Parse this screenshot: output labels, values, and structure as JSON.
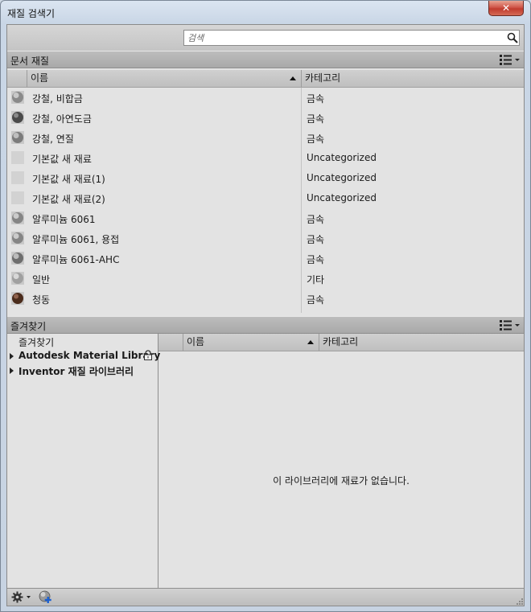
{
  "window": {
    "title": "재질 검색기",
    "close_glyph": "✕"
  },
  "search": {
    "placeholder": "검색",
    "value": ""
  },
  "document_section": {
    "title": "문서 재질",
    "columns": {
      "name": "이름",
      "category": "카테고리"
    },
    "rows": [
      {
        "name": "강철, 비합금",
        "category": "금속",
        "thumb": "sphere-gray"
      },
      {
        "name": "강철, 아연도금",
        "category": "금속",
        "thumb": "sphere-dark"
      },
      {
        "name": "강철, 연질",
        "category": "금속",
        "thumb": "sphere-gray"
      },
      {
        "name": "기본값 새 재료",
        "category": "Uncategorized",
        "thumb": "blank"
      },
      {
        "name": "기본값 새 재료(1)",
        "category": "Uncategorized",
        "thumb": "blank"
      },
      {
        "name": "기본값 새 재료(2)",
        "category": "Uncategorized",
        "thumb": "blank"
      },
      {
        "name": "알루미늄 6061",
        "category": "금속",
        "thumb": "sphere-gray"
      },
      {
        "name": "알루미늄 6061, 용접",
        "category": "금속",
        "thumb": "sphere-gray"
      },
      {
        "name": "알루미늄 6061-AHC",
        "category": "금속",
        "thumb": "sphere-gray"
      },
      {
        "name": "일반",
        "category": "기타",
        "thumb": "sphere-light"
      },
      {
        "name": "청동",
        "category": "금속",
        "thumb": "sphere-bronze"
      }
    ]
  },
  "favorites_section": {
    "title": "즐겨찾기",
    "tree": [
      {
        "label": "즐겨찾기",
        "expandable": false,
        "locked": false
      },
      {
        "label": "Autodesk Material Library",
        "expandable": true,
        "locked": true
      },
      {
        "label": "Inventor 재질 라이브러리",
        "expandable": true,
        "locked": false
      }
    ],
    "columns": {
      "name": "이름",
      "category": "카테고리"
    },
    "empty_message": "이 라이브러리에 재료가 없습니다."
  },
  "bottom_bar": {
    "icons": [
      "gear-icon",
      "add-material-icon"
    ]
  },
  "colors": {
    "title_bar": "#c9d6e6",
    "panel_bg": "#e3e3e3",
    "close_button": "#c13c2e"
  }
}
